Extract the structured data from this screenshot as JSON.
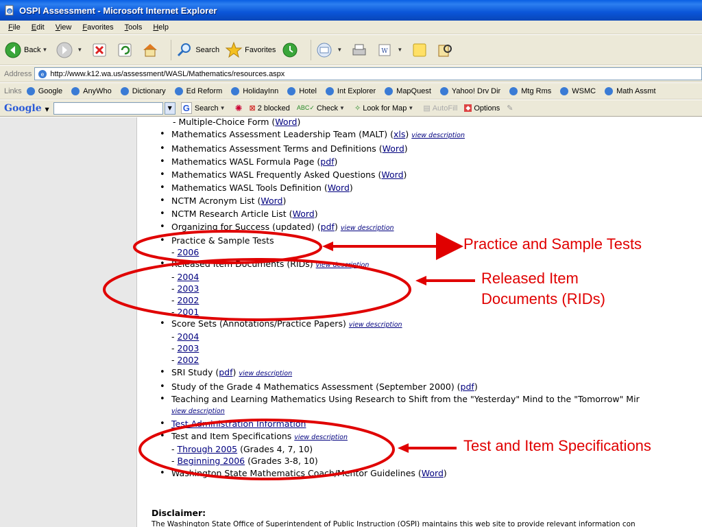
{
  "window": {
    "title": "OSPI Assessment - Microsoft Internet Explorer"
  },
  "menu": [
    "File",
    "Edit",
    "View",
    "Favorites",
    "Tools",
    "Help"
  ],
  "toolbar": {
    "back": "Back",
    "search": "Search",
    "favorites": "Favorites"
  },
  "address": {
    "label": "Address",
    "url": "http://www.k12.wa.us/assessment/WASL/Mathematics/resources.aspx"
  },
  "links": {
    "label": "Links",
    "items": [
      "Google",
      "AnyWho",
      "Dictionary",
      "Ed Reform",
      "HolidayInn",
      "Hotel",
      "Int Explorer",
      "MapQuest",
      "Yahoo! Drv Dir",
      "Mtg Rms",
      "WSMC",
      "Math Assmt"
    ]
  },
  "google": {
    "logo": "Google",
    "search": "Search",
    "blocked": "2 blocked",
    "check": "Check",
    "lookfor": "Look for Map",
    "autofill": "AutoFill",
    "options": "Options"
  },
  "content": {
    "vd": "view description",
    "multiple_choice": {
      "text": "- Multiple-Choice Form (",
      "link": "Word",
      "end": ")"
    },
    "malt": {
      "text": "Mathematics Assessment Leadership Team (MALT) (",
      "link": "xls",
      "end": ")"
    },
    "terms": {
      "text": "Mathematics Assessment Terms and Definitions (",
      "link": "Word",
      "end": ")"
    },
    "formula": {
      "text": "Mathematics WASL Formula Page (",
      "link": "pdf",
      "end": ")"
    },
    "faq": {
      "text": "Mathematics WASL Frequently Asked Questions (",
      "link": "Word",
      "end": ")"
    },
    "tools": {
      "text": "Mathematics WASL Tools Definition (",
      "link": "Word",
      "end": ")"
    },
    "acronym": {
      "text": "NCTM Acronym List (",
      "link": "Word",
      "end": ")"
    },
    "research": {
      "text": "NCTM Research Article List (",
      "link": "Word",
      "end": ")"
    },
    "organizing": {
      "text": "Organizing for Success (updated) (",
      "link": "pdf",
      "end": ")"
    },
    "practice": {
      "text": "Practice & Sample Tests",
      "years": [
        "2006"
      ]
    },
    "rids": {
      "text": "Released Item Documents (RIDs)",
      "years": [
        "2004",
        "2003",
        "2002",
        "2001"
      ]
    },
    "score": {
      "text": "Score Sets (Annotations/Practice Papers)",
      "years": [
        "2004",
        "2003",
        "2002"
      ]
    },
    "sri": {
      "text": "SRI Study (",
      "link": "pdf",
      "end": ")"
    },
    "grade4": {
      "text": "Study of the Grade 4 Mathematics Assessment (September 2000) (",
      "link": "pdf",
      "end": ")"
    },
    "teaching": {
      "text": "Teaching and Learning Mathematics Using Research to Shift from the \"Yesterday\" Mind to the \"Tomorrow\" Mir"
    },
    "test_admin": {
      "link": "Test Administration Information"
    },
    "test_spec": {
      "text": "Test and Item Specifications",
      "through": "Through 2005",
      "through_grades": "(Grades 4, 7, 10)",
      "beginning": "Beginning 2006",
      "beginning_grades": "(Grades 3-8, 10)"
    },
    "coach": {
      "text": "Washington State Mathematics Coach/Mentor Guidelines (",
      "link": "Word",
      "end": ")"
    },
    "disclaimer_title": "Disclaimer:",
    "disclaimer_text": "The Washington State Office of Superintendent of Public Instruction (OSPI) maintains this web site to provide relevant information con"
  },
  "annotations": {
    "practice": "Practice and Sample Tests",
    "rids_line1": "Released Item",
    "rids_line2": "Documents (RIDs)",
    "spec": "Test and Item Specifications",
    "color": "#e00000"
  }
}
